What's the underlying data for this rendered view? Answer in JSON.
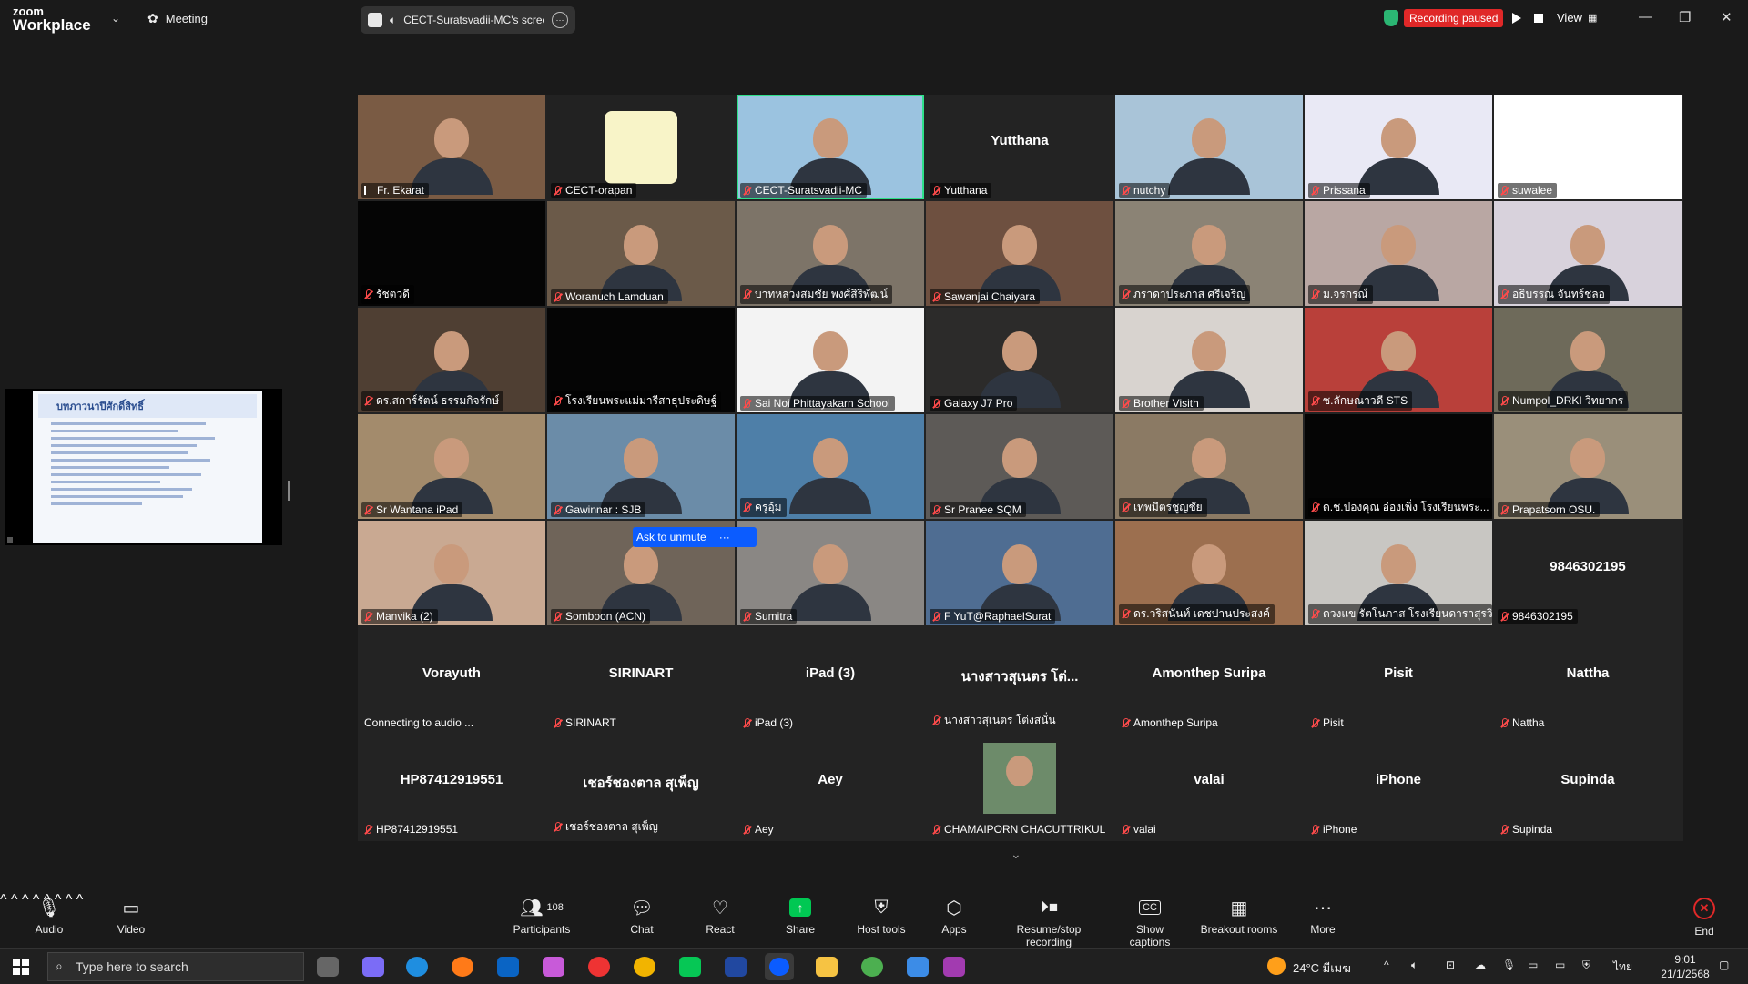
{
  "titlebar": {
    "logo_top": "zoom",
    "logo_bottom": "Workplace",
    "meeting_label": "Meeting",
    "share_label": "CECT-Suratsvadii-MC's screen",
    "recording_status": "Recording paused",
    "view_label": "View"
  },
  "shared_slide": {
    "title": "บทภาวนาปีศักดิ์สิทธิ์"
  },
  "ask_to_unmute": "Ask to unmute",
  "video_tiles": [
    {
      "name": "Fr. Ekarat",
      "bg": "#7a5b44",
      "muted": false
    },
    {
      "name": "CECT-orapan",
      "bg": "#222222",
      "muted": true,
      "logo": true
    },
    {
      "name": "CECT-Suratsvadii-MC",
      "bg": "#9bc3e0",
      "muted": true,
      "active": true
    },
    {
      "name": "Yutthana",
      "bg": "#232323",
      "muted": true,
      "big": "Yutthana"
    },
    {
      "name": "nutchy",
      "bg": "#a9c4d8",
      "muted": true
    },
    {
      "name": "Prissana",
      "bg": "#e9e9f5",
      "muted": true
    },
    {
      "name": "suwalee",
      "bg": "#ffffff",
      "muted": true
    },
    {
      "name": "รัชตวดี",
      "bg": "#050505",
      "muted": true
    },
    {
      "name": "Woranuch Lamduan",
      "bg": "#6b5a49",
      "muted": true
    },
    {
      "name": "บาทหลวงสมชัย พงศ์สิริพัฒน์",
      "bg": "#7d7468",
      "muted": true
    },
    {
      "name": "Sawanjai Chaiyara",
      "bg": "#6e5040",
      "muted": true
    },
    {
      "name": "ภราดาประภาส ศรีเจริญ",
      "bg": "#8b8375",
      "muted": true
    },
    {
      "name": "ม.จรกรณ์",
      "bg": "#b9a7a3",
      "muted": true
    },
    {
      "name": "อธิบรรณ จันทร์ชลอ",
      "bg": "#d8d2dc",
      "muted": true
    },
    {
      "name": "ดร.สการ์รัตน์ ธรรมกิจรักษ์",
      "bg": "#4f3f33",
      "muted": true
    },
    {
      "name": "โรงเรียนพระแม่มารีสาธุประดิษฐ์",
      "bg": "#050505",
      "muted": true
    },
    {
      "name": "Sai Noi Phittayakarn School",
      "bg": "#f3f3f3",
      "muted": true
    },
    {
      "name": "Galaxy J7 Pro",
      "bg": "#2c2b2a",
      "muted": true
    },
    {
      "name": "Brother Visith",
      "bg": "#d8d3cf",
      "muted": true
    },
    {
      "name": "ซ.ลักษณาวดี STS",
      "bg": "#b9403a",
      "muted": true
    },
    {
      "name": "Numpol_DRKI วิทยากร",
      "bg": "#6e6a5a",
      "muted": true
    },
    {
      "name": "Sr Wantana iPad",
      "bg": "#a38b6c",
      "muted": true
    },
    {
      "name": "Gawinnar : SJB",
      "bg": "#6b8ca8",
      "muted": true
    },
    {
      "name": "ครูอุ้ม",
      "bg": "#4e7fa8",
      "muted": true
    },
    {
      "name": "Sr Pranee SQM",
      "bg": "#5d5a57",
      "muted": true
    },
    {
      "name": "เทพมีตรชูญชัย",
      "bg": "#8b7a64",
      "muted": true
    },
    {
      "name": "ด.ช.ปองคุณ อ่องเพิ่ง โรงเรียนพระ...",
      "bg": "#050505",
      "muted": true
    },
    {
      "name": "Prapatsorn OSU.",
      "bg": "#9a8f7a",
      "muted": true
    },
    {
      "name": "Manvika (2)",
      "bg": "#c9a992",
      "muted": true
    },
    {
      "name": "Somboon (ACN)",
      "bg": "#6f6459",
      "muted": true
    },
    {
      "name": "Sumitra",
      "bg": "#8a8784",
      "muted": true
    },
    {
      "name": "F YuT@RaphaelSurat",
      "bg": "#4f6d92",
      "muted": true
    },
    {
      "name": "ดร.วริสนันท์ เดชปานประสงค์",
      "bg": "#9c6f4f",
      "muted": true
    },
    {
      "name": "ดวงแข รัตโนภาส โรงเรียนดาราสุรวิทยา",
      "bg": "#c8c6c2",
      "muted": true
    },
    {
      "name": "9846302195",
      "bg": "#232323",
      "muted": true,
      "big": "9846302195"
    }
  ],
  "name_tiles": [
    {
      "big": "Vorayuth",
      "small": "Connecting to audio ...",
      "muted": false
    },
    {
      "big": "SIRINART",
      "small": "SIRINART",
      "muted": true
    },
    {
      "big": "iPad (3)",
      "small": "iPad (3)",
      "muted": true
    },
    {
      "big": "นางสาวสุเนตร โต่...",
      "small": "นางสาวสุเนตร โต่งสนั่น",
      "muted": true
    },
    {
      "big": "Amonthep Suripa",
      "small": "Amonthep Suripa",
      "muted": true
    },
    {
      "big": "Pisit",
      "small": "Pisit",
      "muted": true
    },
    {
      "big": "Nattha",
      "small": "Nattha",
      "muted": true
    },
    {
      "big": "HP87412919551",
      "small": "HP87412919551",
      "muted": true
    },
    {
      "big": "เชอร์ชองตาล สุเพ็ญ",
      "small": "เชอร์ชองตาล สุเพ็ญ",
      "muted": true
    },
    {
      "big": "Aey",
      "small": "Aey",
      "muted": true
    },
    {
      "big": "",
      "small": "CHAMAIPORN CHACUTTRIKUL",
      "muted": true,
      "avatar": true
    },
    {
      "big": "valai",
      "small": "valai",
      "muted": true
    },
    {
      "big": "iPhone",
      "small": "iPhone",
      "muted": true
    },
    {
      "big": "Supinda",
      "small": "Supinda",
      "muted": true
    }
  ],
  "toolbar": {
    "audio": "Audio",
    "video": "Video",
    "participants": "Participants",
    "participants_count": "108",
    "chat": "Chat",
    "react": "React",
    "share": "Share",
    "host_tools": "Host tools",
    "apps": "Apps",
    "recording": "Resume/stop recording",
    "captions": "Show captions",
    "breakout": "Breakout rooms",
    "more": "More",
    "end": "End"
  },
  "taskbar": {
    "search_placeholder": "Type here to search",
    "weather": "24°C มีเมฆ",
    "lang": "ไทย",
    "time": "9:01",
    "date": "21/1/2568"
  },
  "colors": {
    "accent_green": "#2ee08a",
    "record_red": "#e02828",
    "share_green": "#00c853",
    "zoom_blue": "#0b5cff"
  }
}
